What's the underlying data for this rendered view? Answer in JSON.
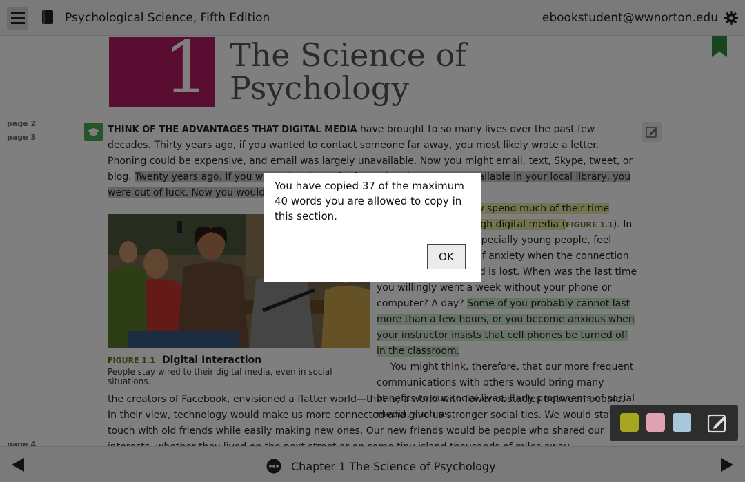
{
  "header": {
    "title": "Psychological Science, Fifth Edition",
    "user_email": "ebookstudent@wwnorton.edu"
  },
  "chapter": {
    "number": "1",
    "title_line1": "The Science of",
    "title_line2": "Psychology"
  },
  "page_labels": [
    "page 2",
    "page 3",
    "page 4"
  ],
  "content": {
    "lead_bold": "THINK OF THE ADVANTAGES THAT DIGITAL MEDIA",
    "p1_plain": " have brought to so many lives over the past few decades. Thirty years ago, if you wanted to contact someone far away, you most likely wrote a letter. Phoning could be expensive, and email was largely unavailable. Now you might email, text, Skype, tweet, or blog. ",
    "p1_highlight": "Twenty years ago, if you wanted a piece of information that was not available in your local library, you were out of luck. Now you would probably go straight to the Internet.",
    "p2_highlight": "Millions of people now spend much of their time communicating through digital media (",
    "p2_figref": "FIGURE 1.1",
    "p2_rest": "). In fact, many people, especially young people, feel panicky to the point of anxiety when the connection to the electronic world is lost. When was the last time you willingly went a week without your phone or computer? A day? ",
    "p2_green": "Some of you probably cannot last more than a few hours, or you become anxious when your instructor insists that cell phones be turned off in the classroom.",
    "p3_indent": "You might think, therefore, that our more frequent communications with others would bring many benefits to our social lives. Early proponents of social media, such as",
    "p3_full": "the creators of Facebook, envisioned a flatter world—that is, a world with fewer obstacles between people. In their view, technology would make us more connected and give us stronger social ties. We would stay in touch with old friends while easily making new ones. Our new friends would be people who shared our interests, whether they lived on the next street or on some tiny island thousands of miles away."
  },
  "figure": {
    "label": "FIGURE 1.1",
    "title": "Digital Interaction",
    "caption": "People stay wired to their digital media, even in social situations."
  },
  "dialog": {
    "message": "You have copied 37 of the maximum 40 words you are allowed to copy in this section.",
    "ok_label": "OK"
  },
  "footer": {
    "chapter_label": "Chapter 1 The Science of Psychology"
  },
  "palette": {
    "colors": [
      "#a6a51e",
      "#e0a1b2",
      "#a6c8da"
    ]
  },
  "icons": [
    "menu-icon",
    "book-icon",
    "gear-icon",
    "bookmark-icon",
    "graduation-cap-icon",
    "edit-icon",
    "prev-arrow-icon",
    "next-arrow-icon",
    "more-icon",
    "note-icon"
  ]
}
